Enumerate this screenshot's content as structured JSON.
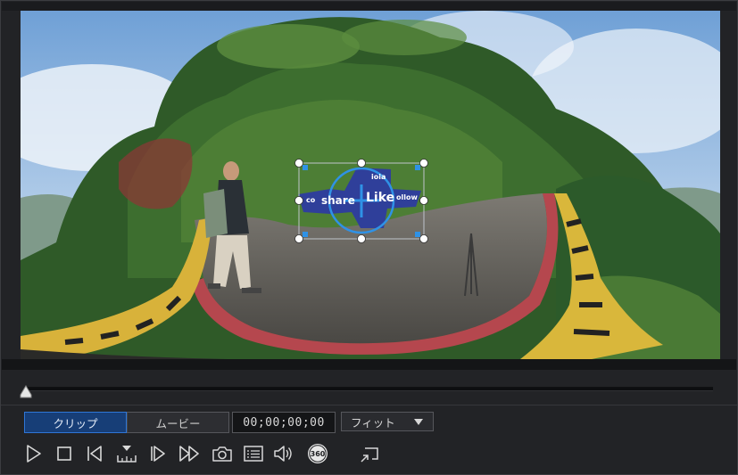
{
  "colors": {
    "accent": "#2f76d6",
    "active_tab_bg": "#173e77",
    "panel_bg": "#222326",
    "icon": "#d8d8d8"
  },
  "viewport": {
    "overlay_text": {
      "share": "share",
      "like": "Like",
      "follow": "ollow",
      "co": "co",
      "top": "ioia"
    }
  },
  "timeline": {
    "position": 0
  },
  "mode_tabs": [
    {
      "label": "クリップ",
      "active": true
    },
    {
      "label": "ムービー",
      "active": false
    }
  ],
  "timecode": "00;00;00;00",
  "zoom": {
    "selected": "フィット"
  },
  "controls": [
    {
      "name": "play-icon"
    },
    {
      "name": "stop-icon"
    },
    {
      "name": "previous-frame-icon"
    },
    {
      "name": "split-icon"
    },
    {
      "name": "next-frame-icon"
    },
    {
      "name": "fast-forward-icon"
    },
    {
      "name": "snapshot-camera-icon"
    },
    {
      "name": "subtitle-icon"
    },
    {
      "name": "volume-icon"
    },
    {
      "name": "360-view-icon",
      "label": "360"
    },
    {
      "name": "undock-window-icon"
    }
  ]
}
